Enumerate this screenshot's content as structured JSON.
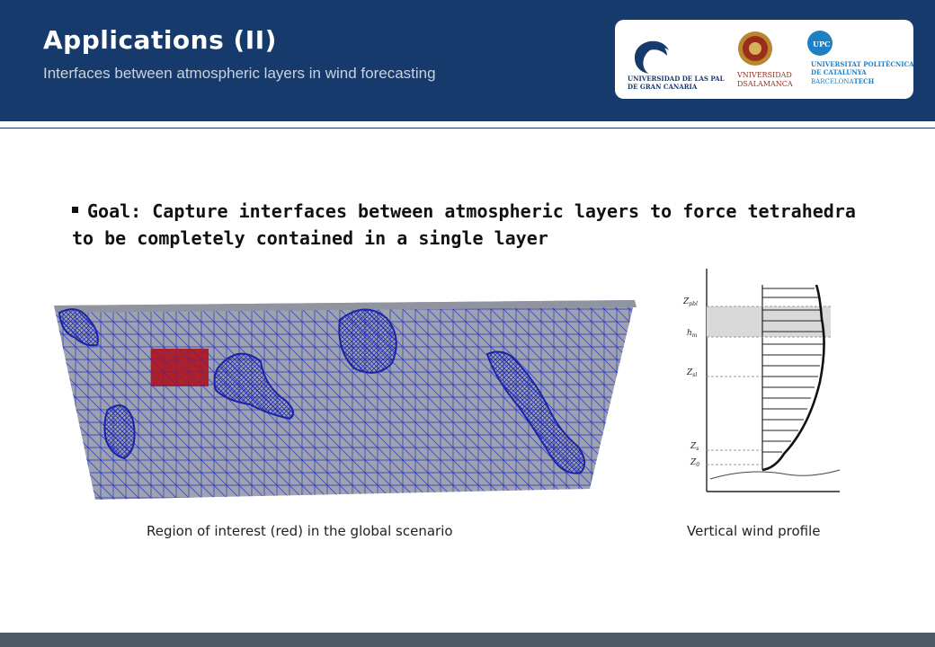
{
  "header": {
    "title": "Applications (II)",
    "subtitle": "Interfaces between atmospheric layers in wind forecasting"
  },
  "logos": {
    "ulpgc": [
      "UNIVERSIDAD DE LAS PALMAS",
      "DE GRAN CANARIA"
    ],
    "salamanca": [
      "VNIVERSIDAD",
      "DSALAMANCA"
    ],
    "upc": [
      "UNIVERSITAT POLITÈCNICA",
      "DE CATALUNYA",
      "BARCELONA",
      "TECH",
      "UPC"
    ]
  },
  "goal": {
    "text": "Goal: Capture interfaces between atmospheric layers to force tetrahedra to be completely contained in a single layer"
  },
  "figures": {
    "mesh_caption": "Region of interest (red) in the global scenario",
    "profile_caption": "Vertical wind profile",
    "profile_labels": {
      "zpbl": "Z",
      "zpbl_sub": "pbl",
      "hm": "h",
      "hm_sub": "m",
      "zsl": "Z",
      "zsl_sub": "sl",
      "zs": "Z",
      "zs_sub": "s",
      "z0": "Z",
      "z0_sub": "0"
    }
  },
  "colors": {
    "header_bg": "#163a6b",
    "mesh_fill": "#9da2ac",
    "mesh_lines": "#1f2bb8",
    "region_red": "#b3121a",
    "footer": "#4c5a63"
  }
}
